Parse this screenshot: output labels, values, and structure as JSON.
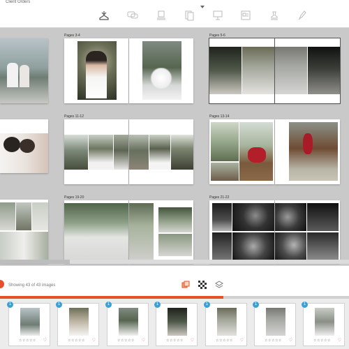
{
  "window": {
    "tab_title": "Client Orders"
  },
  "toolbar": {
    "icons": [
      "album-icon",
      "comments-icon",
      "stack-icon",
      "pages-icon",
      "presentation-icon",
      "layout-icon",
      "stamp-icon",
      "pen-icon"
    ]
  },
  "spreads": [
    {
      "label": ""
    },
    {
      "label": "Pages 3-4"
    },
    {
      "label": "Pages 5-6"
    },
    {
      "label": ""
    },
    {
      "label": "Pages 11-12"
    },
    {
      "label": "Pages 13-14"
    },
    {
      "label": ""
    },
    {
      "label": "Pages 19-20"
    },
    {
      "label": "Pages 21-22"
    }
  ],
  "status": {
    "text": "Showing 43 of 43 images"
  },
  "filmstrip": {
    "thumbs": [
      {
        "badge": "1",
        "stars": "☆☆☆☆☆",
        "heart": "♡"
      },
      {
        "badge": "1",
        "stars": "☆☆☆☆☆",
        "heart": "♡"
      },
      {
        "badge": "1",
        "stars": "☆☆☆☆☆",
        "heart": "♡"
      },
      {
        "badge": "1",
        "stars": "☆☆☆☆☆",
        "heart": "♡"
      },
      {
        "badge": "1",
        "stars": "☆☆☆☆☆",
        "heart": "♡"
      },
      {
        "badge": "1",
        "stars": "☆☆☆☆☆",
        "heart": "♡"
      },
      {
        "badge": "1",
        "stars": "☆☆☆☆☆",
        "heart": "♡"
      }
    ]
  },
  "colors": {
    "accent": "#e45027",
    "badge": "#3aa0d8",
    "canvas": "#c9c9c9"
  }
}
